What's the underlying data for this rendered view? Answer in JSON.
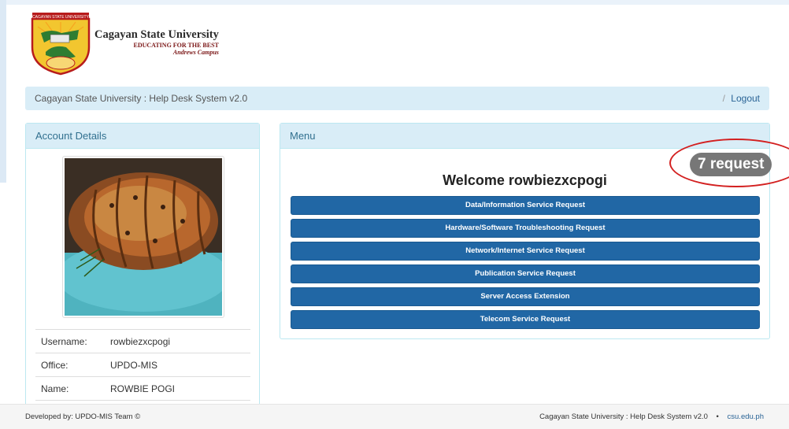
{
  "header": {
    "logo_ribbon": "CAGAYAN STATE UNIVERSITY",
    "university_name": "Cagayan State University",
    "motto": "EDUCATING FOR THE BEST",
    "campus": "Andrews Campus"
  },
  "navbar": {
    "title": "Cagayan State University : Help Desk System v2.0",
    "separator": "/",
    "logout_label": "Logout"
  },
  "account": {
    "heading": "Account Details",
    "photo_icon": "roast-pork-photo",
    "fields": [
      {
        "label": "Username:",
        "value": "rowbiezxcpogi"
      },
      {
        "label": "Office:",
        "value": "UPDO-MIS"
      },
      {
        "label": "Name:",
        "value": "ROWBIE POGI"
      }
    ]
  },
  "menu": {
    "heading": "Menu",
    "welcome": "Welcome rowbiezxcpogi",
    "request_badge": "7 request",
    "items": [
      "Data/Information Service Request",
      "Hardware/Software Troubleshooting Request",
      "Network/Internet Service Request",
      "Publication Service Request",
      "Server Access Extension",
      "Telecom Service Request"
    ]
  },
  "footer": {
    "left": "Developed by: UPDO-MIS Team ©",
    "right": "Cagayan State University : Help Desk System v2.0",
    "bullet": "•",
    "link": "csu.edu.ph"
  },
  "colors": {
    "accent": "#2167a5",
    "panel_heading_bg": "#d9edf7",
    "badge_bg": "#777777",
    "highlight_ring": "#d32020"
  }
}
